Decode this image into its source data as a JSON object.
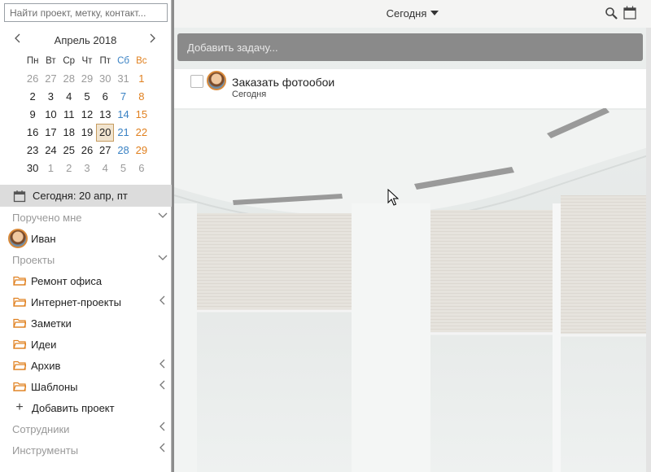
{
  "search": {
    "placeholder": "Найти проект, метку, контакт..."
  },
  "calendar": {
    "title": "Апрель 2018",
    "dows": [
      "Пн",
      "Вт",
      "Ср",
      "Чт",
      "Пт",
      "Сб",
      "Вс"
    ],
    "weeks": [
      [
        "26",
        "27",
        "28",
        "29",
        "30",
        "31",
        "1"
      ],
      [
        "2",
        "3",
        "4",
        "5",
        "6",
        "7",
        "8"
      ],
      [
        "9",
        "10",
        "11",
        "12",
        "13",
        "14",
        "15"
      ],
      [
        "16",
        "17",
        "18",
        "19",
        "20",
        "21",
        "22"
      ],
      [
        "23",
        "24",
        "25",
        "26",
        "27",
        "28",
        "29"
      ],
      [
        "30",
        "1",
        "2",
        "3",
        "4",
        "5",
        "6"
      ]
    ],
    "colors": {
      "saturday": "#3a82c4",
      "sunday": "#e0801f",
      "other_month": "#9b9b9b",
      "selected_bg": "#f1e4cf"
    }
  },
  "today_bar": {
    "label": "Сегодня: 20 апр, пт"
  },
  "sidebar": {
    "assigned_header": "Поручено мне",
    "assigned_user": "Иван",
    "projects_header": "Проекты",
    "projects": [
      {
        "label": "Ремонт офиса"
      },
      {
        "label": "Интернет-проекты"
      },
      {
        "label": "Заметки"
      },
      {
        "label": "Идеи"
      },
      {
        "label": "Архив"
      },
      {
        "label": "Шаблоны"
      }
    ],
    "add_project": "Добавить проект",
    "employees_header": "Сотрудники",
    "tools_header": "Инструменты"
  },
  "main": {
    "view_title": "Сегодня",
    "add_task_placeholder": "Добавить задачу...",
    "tasks": [
      {
        "title": "Заказать фотообои",
        "date": "Сегодня"
      }
    ],
    "accent_color": "#e0801f"
  }
}
